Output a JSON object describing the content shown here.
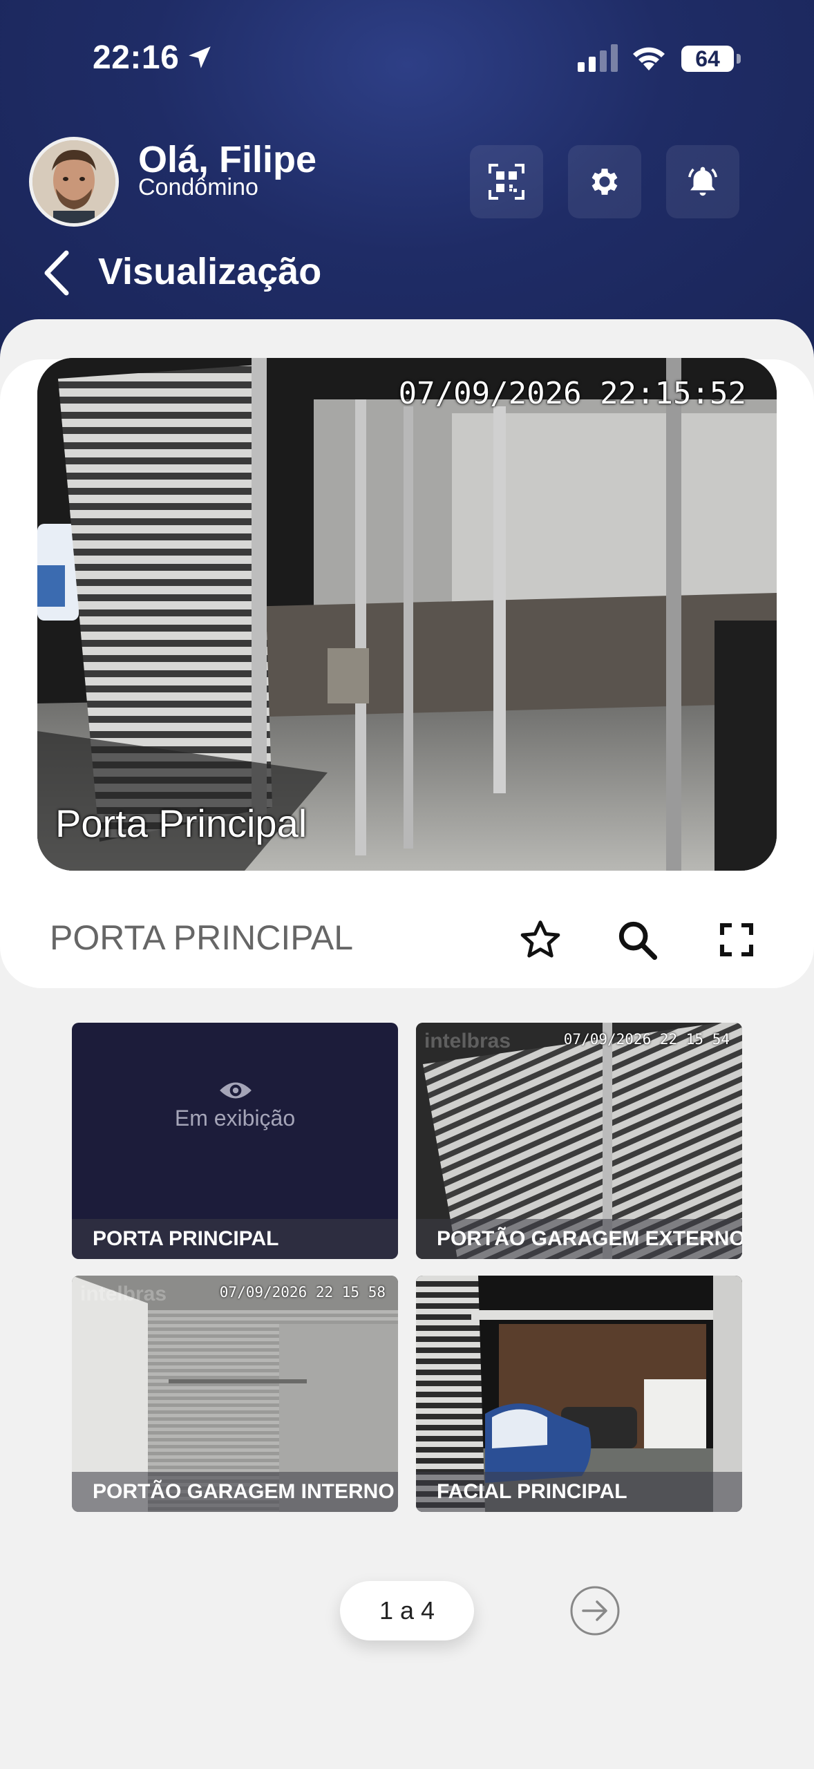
{
  "status_bar": {
    "time": "22:16",
    "battery": "64"
  },
  "header": {
    "greeting": "Olá, Filipe",
    "role": "Condômino",
    "title": "Visualização",
    "icons": [
      "qr-code-icon",
      "gear-icon",
      "bell-icon"
    ]
  },
  "player": {
    "timestamp": "07/09/2026 22:15:52",
    "overlay_caption": "Porta Principal",
    "camera_name": "PORTA PRINCIPAL",
    "controls": [
      "star-icon",
      "search-icon",
      "fullscreen-icon"
    ]
  },
  "thumbnails": [
    {
      "label": "PORTA PRINCIPAL",
      "status": "Em exibição"
    },
    {
      "label": "PORTÃO GARAGEM EXTERNO",
      "timestamp": "07/09/2026 22 15 54",
      "brand": "intelbras"
    },
    {
      "label": "PORTÃO GARAGEM INTERNO",
      "timestamp": "07/09/2026 22 15 58",
      "brand": "intelbras"
    },
    {
      "label": "FACIAL PRINCIPAL"
    }
  ],
  "pager": {
    "text": "1 a 4"
  },
  "colors": {
    "header": "#1f2c66",
    "active_thumb": "#1c1c3a",
    "background": "#f1f1f1"
  }
}
